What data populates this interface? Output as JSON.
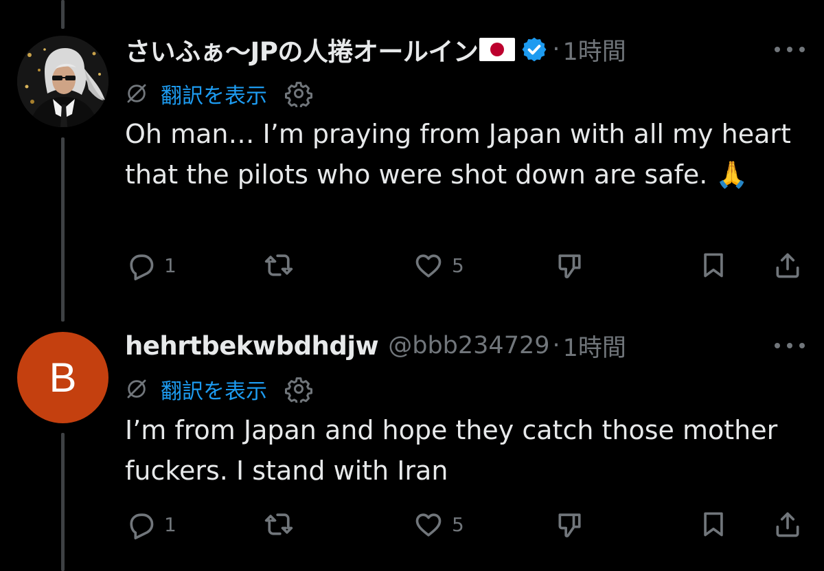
{
  "tweets": [
    {
      "name": "さいふぁ〜JPの人捲オールイン",
      "handle": "",
      "separator": "·",
      "time": "1時間",
      "translate_label": "翻訳を表示",
      "body": "Oh man… I’m praying from Japan with all my heart that the pilots who were shot down are safe. 🙏",
      "reply_count": "1",
      "like_count": "5",
      "verified": true,
      "flag": "JP"
    },
    {
      "name": "hehrtbekwbdhdjw",
      "handle": "@bbb234729",
      "separator": "·",
      "time": "1時間",
      "translate_label": "翻訳を表示",
      "body": "I’m from Japan and hope they catch those mother fuckers. I stand with Iran",
      "reply_count": "1",
      "like_count": "5",
      "avatar_letter": "B",
      "avatar_color": "#c4400f"
    }
  ],
  "colors": {
    "background": "#000000",
    "text_primary": "#e7e9ea",
    "text_secondary": "#71767b",
    "link": "#1d9bf0",
    "verified": "#1d9bf0",
    "thread_line": "#3e4144"
  },
  "icons": {
    "reply": "reply-icon",
    "repost": "repost-icon",
    "like": "heart-icon",
    "dislike": "thumbs-down-icon",
    "bookmark": "bookmark-icon",
    "share": "share-icon",
    "translate": "translate-icon",
    "settings": "gear-icon",
    "more": "more-dots-icon"
  }
}
